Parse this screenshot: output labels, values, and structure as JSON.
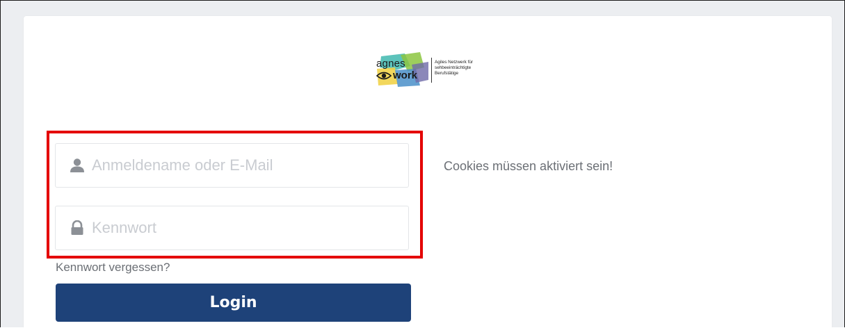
{
  "logo": {
    "word_top": "agnes",
    "word_bottom": "work",
    "tagline_line1": "Agiles Netzwerk für",
    "tagline_line2": "sehbeeinträchtigte",
    "tagline_line3": "Berufstätige",
    "colors": {
      "teal": "#3fb8af",
      "green": "#8cc63f",
      "yellow": "#f1d34a",
      "blue": "#4a8fc9",
      "purple": "#6e6aa8"
    }
  },
  "form": {
    "username": {
      "placeholder": "Anmeldename oder E-Mail",
      "value": "",
      "icon": "user-icon"
    },
    "password": {
      "placeholder": "Kennwort",
      "value": "",
      "icon": "lock-icon"
    },
    "forgot_label": "Kennwort vergessen?",
    "login_label": "Login"
  },
  "cookie_note": "Cookies müssen aktiviert sein!",
  "colors": {
    "primary_button": "#1e4279",
    "highlight": "#e40000",
    "background": "#eceef1"
  }
}
